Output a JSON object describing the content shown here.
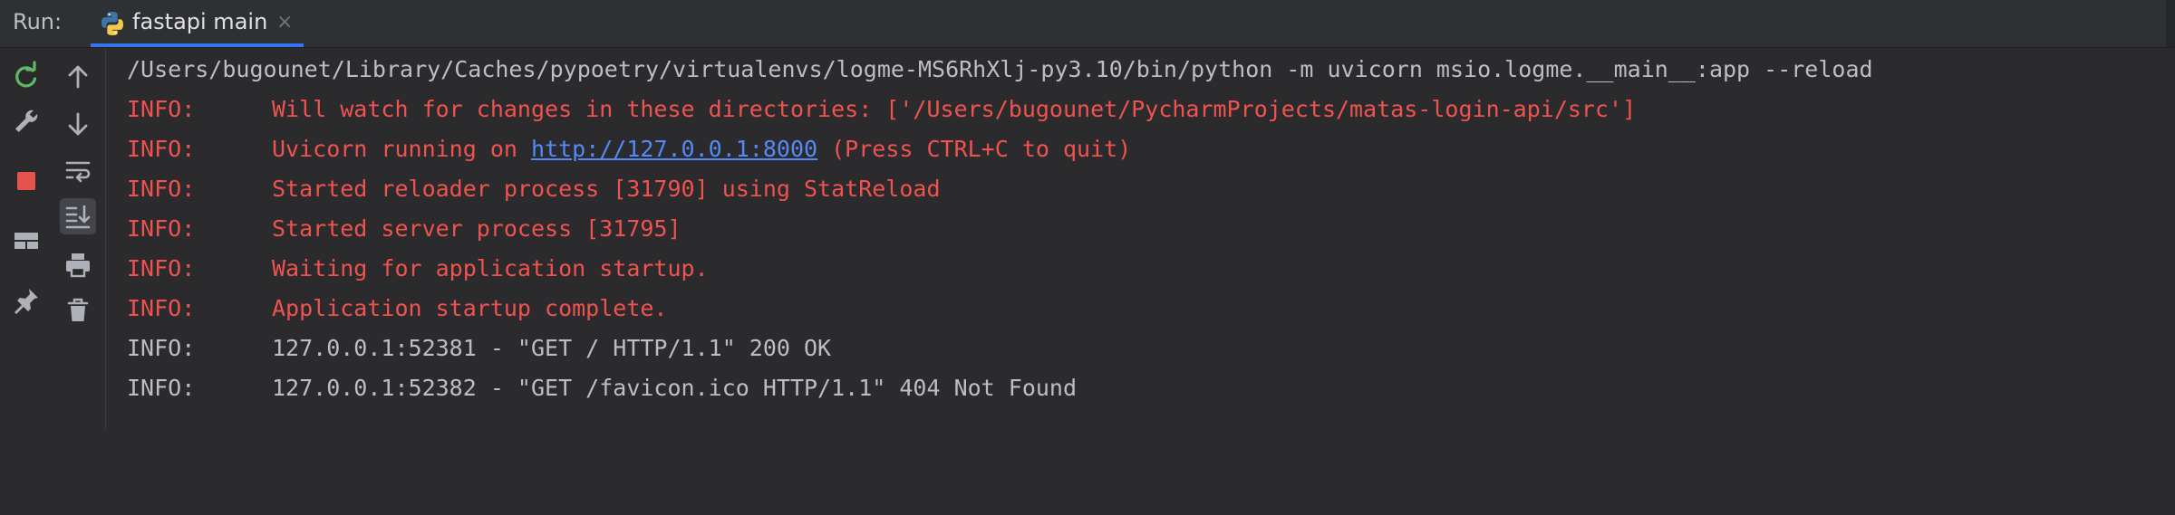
{
  "run_bar": {
    "label": "Run:",
    "tab_title": "fastapi main",
    "close_glyph": "×"
  },
  "left_toolbar": {
    "icons": [
      "rerun-icon",
      "wrench-icon",
      "stop-icon",
      "layout-icon",
      "pin-icon"
    ]
  },
  "second_toolbar": {
    "icons": [
      "up-arrow-icon",
      "down-arrow-icon",
      "soft-wrap-icon",
      "scroll-to-end-icon",
      "print-icon",
      "trash-icon"
    ]
  },
  "console": {
    "command": "/Users/bugounet/Library/Caches/pypoetry/virtualenvs/logme-MS6RhXlj-py3.10/bin/python -m uvicorn msio.logme.__main__:app --reload",
    "lines": [
      {
        "level": "INFO:",
        "text": "Will watch for changes in these directories: ['/Users/bugounet/PycharmProjects/matas-login-api/src']"
      },
      {
        "level": "INFO:",
        "pre": "Uvicorn running on ",
        "link": "http://127.0.0.1:8000",
        "post": " (Press CTRL+C to quit)"
      },
      {
        "level": "INFO:",
        "text": "Started reloader process [31790] using StatReload"
      },
      {
        "level": "INFO:",
        "text": "Started server process [31795]"
      },
      {
        "level": "INFO:",
        "text": "Waiting for application startup."
      },
      {
        "level": "INFO:",
        "text": "Application startup complete."
      },
      {
        "level": "INFO:",
        "text": "127.0.0.1:52381 - \"GET / HTTP/1.1\" 200 OK"
      },
      {
        "level": "INFO:",
        "text": "127.0.0.1:52382 - \"GET /favicon.ico HTTP/1.1\" 404 Not Found"
      }
    ]
  },
  "colors": {
    "error_red": "#f0524f",
    "link_blue": "#548af7",
    "normal_text": "#bcbec4",
    "rerun_green": "#5fb865",
    "stop_red": "#e5534b",
    "tab_accent": "#3574f0"
  }
}
